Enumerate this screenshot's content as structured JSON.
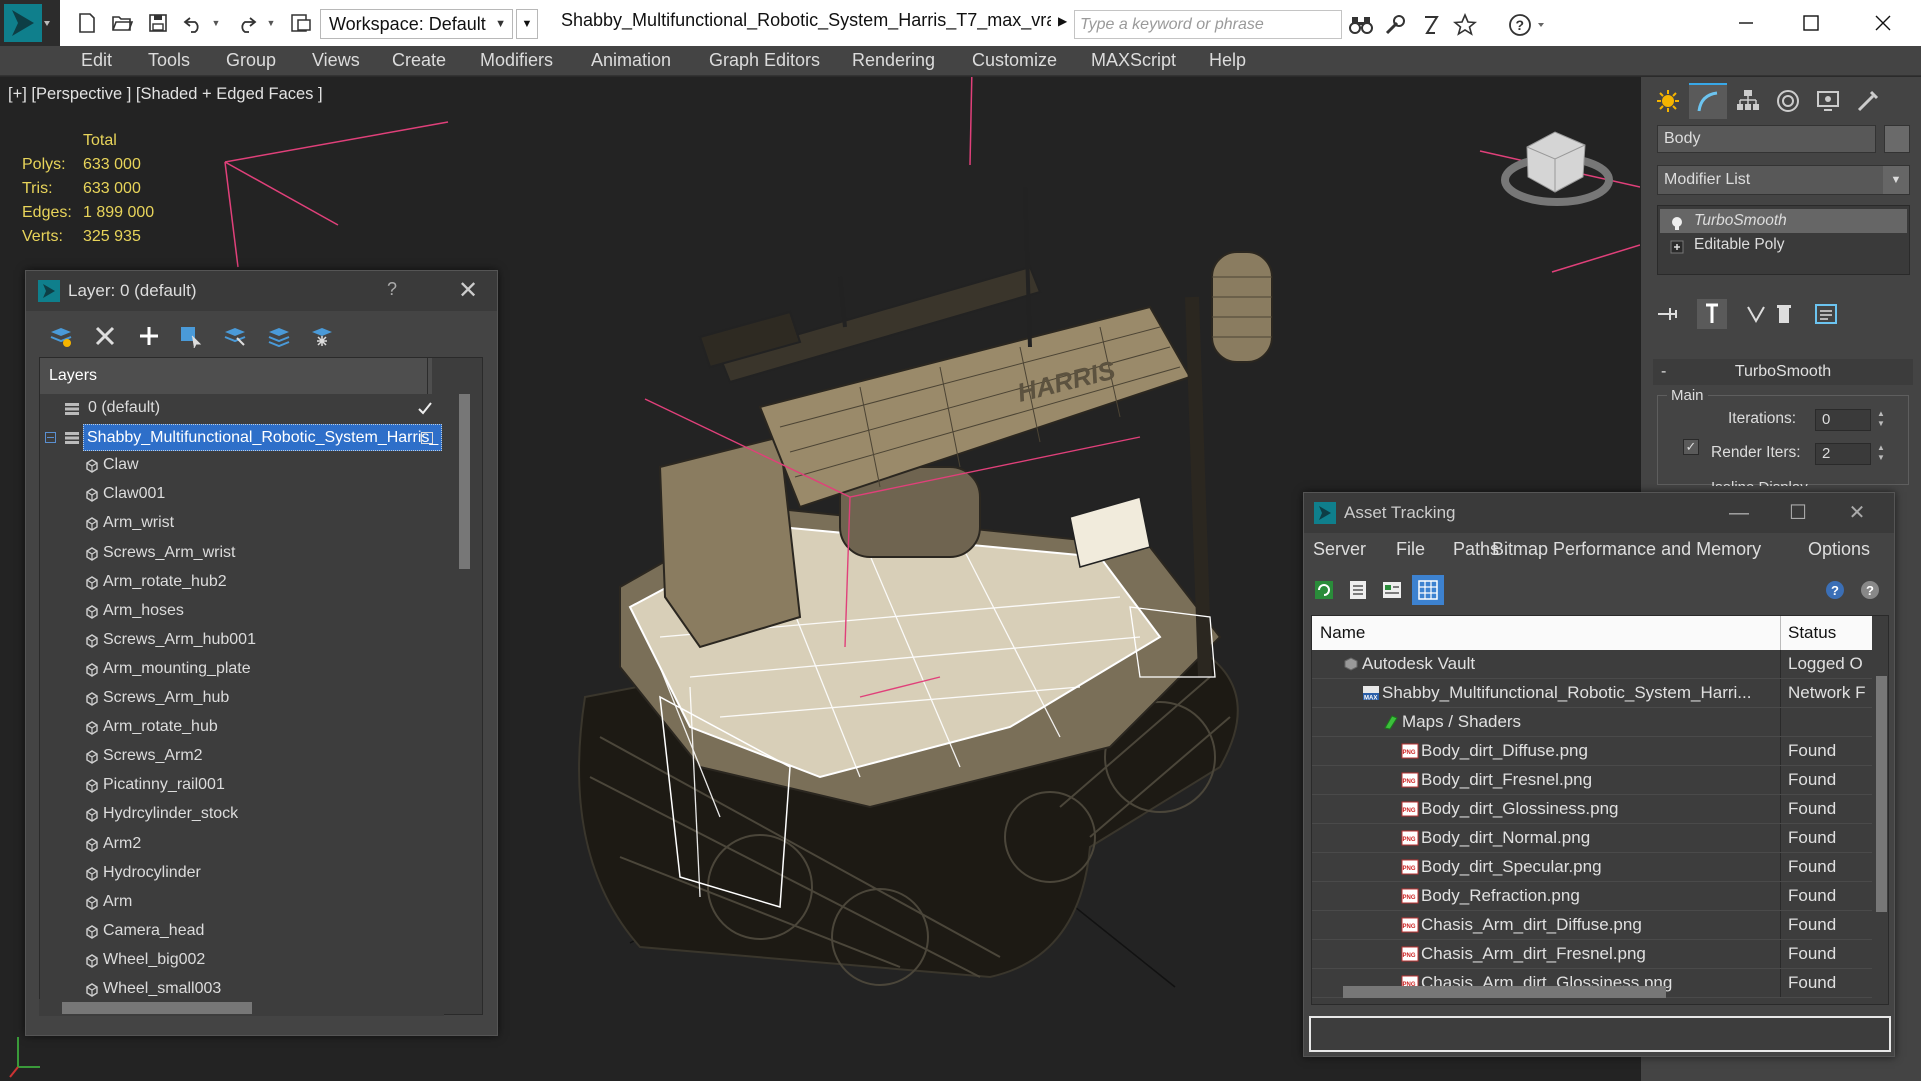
{
  "titlebar": {
    "workspace_label": "Workspace: Default",
    "document_title": "Shabby_Multifunctional_Robotic_System_Harris_T7_max_vra...",
    "search_placeholder": "Type a keyword or phrase"
  },
  "menu": [
    "Edit",
    "Tools",
    "Group",
    "Views",
    "Create",
    "Modifiers",
    "Animation",
    "Graph Editors",
    "Rendering",
    "Customize",
    "MAXScript",
    "Help"
  ],
  "viewport": {
    "label": "[+] [Perspective ] [Shaded + Edged Faces ]",
    "stats": {
      "header": "Total",
      "rows": [
        {
          "label": "Polys:",
          "value": "633 000"
        },
        {
          "label": "Tris:",
          "value": "633 000"
        },
        {
          "label": "Edges:",
          "value": "1 899 000"
        },
        {
          "label": "Verts:",
          "value": "325 935"
        }
      ]
    },
    "model_text": "HARRIS"
  },
  "command_panel": {
    "object_name": "Body",
    "modifier_list": "Modifier List",
    "stack": [
      {
        "label": "TurboSmooth",
        "selected": true
      },
      {
        "label": "Editable Poly",
        "selected": false
      }
    ],
    "rollout": {
      "title": "TurboSmooth",
      "group": "Main",
      "iterations_label": "Iterations:",
      "iterations_value": "0",
      "render_iters_label": "Render Iters:",
      "render_iters_value": "2",
      "render_iters_checked": true,
      "cut_label": "Isoline Display"
    }
  },
  "layer_dialog": {
    "title": "Layer: 0 (default)",
    "help": "?",
    "column_header": "Layers",
    "layers": [
      {
        "label": "0 (default)",
        "level": 0,
        "type": "layer",
        "active": true
      },
      {
        "label": "Shabby_Multifunctional_Robotic_System_Harris_",
        "level": 0,
        "type": "layer",
        "selected": true
      },
      {
        "label": "Claw",
        "level": 1,
        "type": "object"
      },
      {
        "label": "Claw001",
        "level": 1,
        "type": "object"
      },
      {
        "label": "Arm_wrist",
        "level": 1,
        "type": "object"
      },
      {
        "label": "Screws_Arm_wrist",
        "level": 1,
        "type": "object"
      },
      {
        "label": "Arm_rotate_hub2",
        "level": 1,
        "type": "object"
      },
      {
        "label": "Arm_hoses",
        "level": 1,
        "type": "object"
      },
      {
        "label": "Screws_Arm_hub001",
        "level": 1,
        "type": "object"
      },
      {
        "label": "Arm_mounting_plate",
        "level": 1,
        "type": "object"
      },
      {
        "label": "Screws_Arm_hub",
        "level": 1,
        "type": "object"
      },
      {
        "label": "Arm_rotate_hub",
        "level": 1,
        "type": "object"
      },
      {
        "label": "Screws_Arm2",
        "level": 1,
        "type": "object"
      },
      {
        "label": "Picatinny_rail001",
        "level": 1,
        "type": "object"
      },
      {
        "label": "Hydrcylinder_stock",
        "level": 1,
        "type": "object"
      },
      {
        "label": "Arm2",
        "level": 1,
        "type": "object"
      },
      {
        "label": "Hydrocylinder",
        "level": 1,
        "type": "object"
      },
      {
        "label": "Arm",
        "level": 1,
        "type": "object"
      },
      {
        "label": "Camera_head",
        "level": 1,
        "type": "object"
      },
      {
        "label": "Wheel_big002",
        "level": 1,
        "type": "object"
      },
      {
        "label": "Wheel_small003",
        "level": 1,
        "type": "object"
      }
    ]
  },
  "asset_dialog": {
    "title": "Asset Tracking",
    "menu": [
      "Server",
      "File",
      "Paths",
      "Bitmap Performance and Memory",
      "Options"
    ],
    "columns": [
      "Name",
      "Status"
    ],
    "rows": [
      {
        "name": "Autodesk Vault",
        "status": "Logged O",
        "level": 0,
        "icon": "vault"
      },
      {
        "name": "Shabby_Multifunctional_Robotic_System_Harri...",
        "status": "Network F",
        "level": 1,
        "icon": "max"
      },
      {
        "name": "Maps / Shaders",
        "status": "",
        "level": 2,
        "icon": "maps"
      },
      {
        "name": "Body_dirt_Diffuse.png",
        "status": "Found",
        "level": 3,
        "icon": "png"
      },
      {
        "name": "Body_dirt_Fresnel.png",
        "status": "Found",
        "level": 3,
        "icon": "png"
      },
      {
        "name": "Body_dirt_Glossiness.png",
        "status": "Found",
        "level": 3,
        "icon": "png"
      },
      {
        "name": "Body_dirt_Normal.png",
        "status": "Found",
        "level": 3,
        "icon": "png"
      },
      {
        "name": "Body_dirt_Specular.png",
        "status": "Found",
        "level": 3,
        "icon": "png"
      },
      {
        "name": "Body_Refraction.png",
        "status": "Found",
        "level": 3,
        "icon": "png"
      },
      {
        "name": "Chasis_Arm_dirt_Diffuse.png",
        "status": "Found",
        "level": 3,
        "icon": "png"
      },
      {
        "name": "Chasis_Arm_dirt_Fresnel.png",
        "status": "Found",
        "level": 3,
        "icon": "png"
      },
      {
        "name": "Chasis_Arm_dirt_Glossiness.png",
        "status": "Found",
        "level": 3,
        "icon": "png"
      }
    ]
  },
  "colors": {
    "accent": "#2e6fc9",
    "stats_text": "#e8d45a",
    "selection_pink": "#e0407a"
  }
}
